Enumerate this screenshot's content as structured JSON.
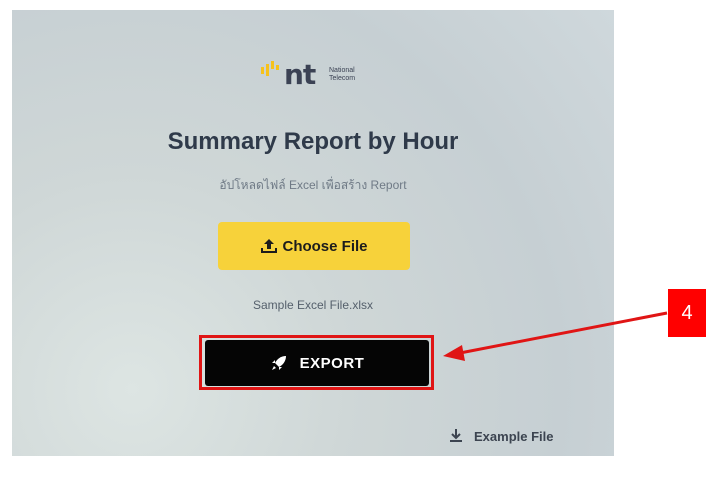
{
  "brand": {
    "mark": "nt",
    "sub_line1": "National",
    "sub_line2": "Telecom"
  },
  "title": "Summary Report by Hour",
  "subtitle": "อัปโหลดไฟล์ Excel เพื่อสร้าง Report",
  "choose_file": {
    "label": "Choose File",
    "icon": "upload-icon",
    "color": "#f7d23a"
  },
  "file_name": "Sample Excel File.xlsx",
  "export": {
    "label": "EXPORT",
    "icon": "rocket-icon",
    "color": "#050505"
  },
  "example_file": {
    "label": "Example File",
    "icon": "download-icon"
  },
  "annotation": {
    "number": "4",
    "color": "#ff0000"
  }
}
